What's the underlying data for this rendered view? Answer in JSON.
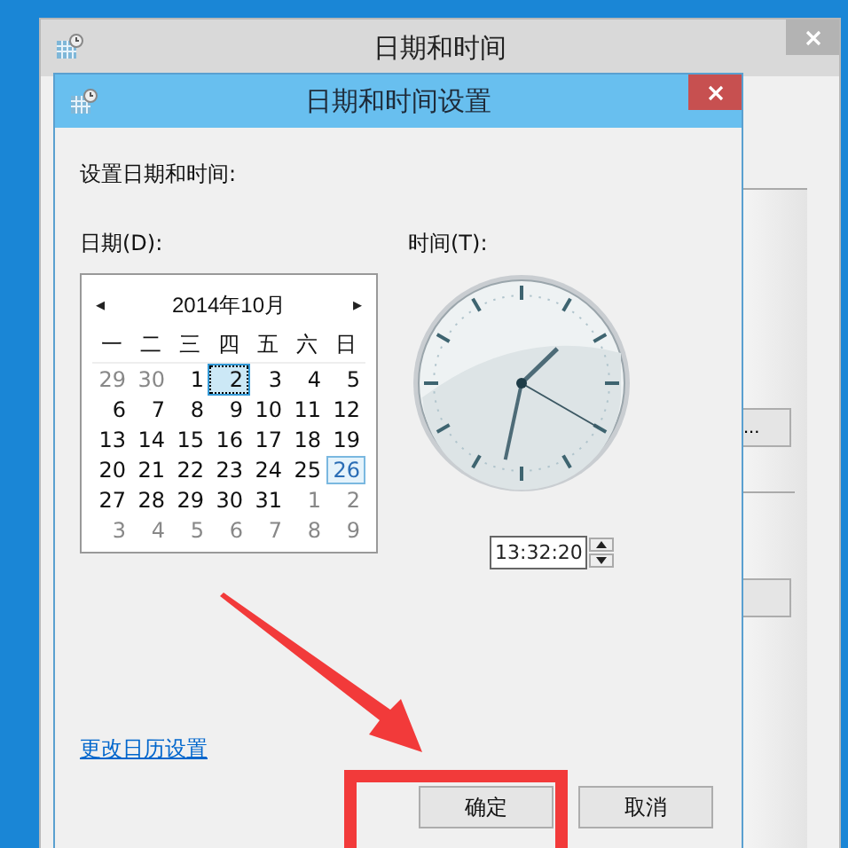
{
  "outer_window": {
    "title": "日期和时间",
    "side_buttons": [
      "..."
    ]
  },
  "dialog": {
    "title": "日期和时间设置",
    "heading": "设置日期和时间:",
    "date_label": "日期(D):",
    "time_label": "时间(T):",
    "calendar": {
      "prev": "◂",
      "next": "▸",
      "month": "2014年10月",
      "weekdays": [
        "一",
        "二",
        "三",
        "四",
        "五",
        "六",
        "日"
      ],
      "weeks": [
        [
          {
            "d": "29",
            "kind": "other",
            "selected": false,
            "today": false
          },
          {
            "d": "30",
            "kind": "other",
            "selected": false,
            "today": false
          },
          {
            "d": "1",
            "kind": "month",
            "selected": false,
            "today": false
          },
          {
            "d": "2",
            "kind": "month",
            "selected": true,
            "today": false
          },
          {
            "d": "3",
            "kind": "month",
            "selected": false,
            "today": false
          },
          {
            "d": "4",
            "kind": "month",
            "selected": false,
            "today": false
          },
          {
            "d": "5",
            "kind": "month",
            "selected": false,
            "today": false
          }
        ],
        [
          {
            "d": "6",
            "kind": "month",
            "selected": false,
            "today": false
          },
          {
            "d": "7",
            "kind": "month",
            "selected": false,
            "today": false
          },
          {
            "d": "8",
            "kind": "month",
            "selected": false,
            "today": false
          },
          {
            "d": "9",
            "kind": "month",
            "selected": false,
            "today": false
          },
          {
            "d": "10",
            "kind": "month",
            "selected": false,
            "today": false
          },
          {
            "d": "11",
            "kind": "month",
            "selected": false,
            "today": false
          },
          {
            "d": "12",
            "kind": "month",
            "selected": false,
            "today": false
          }
        ],
        [
          {
            "d": "13",
            "kind": "month",
            "selected": false,
            "today": false
          },
          {
            "d": "14",
            "kind": "month",
            "selected": false,
            "today": false
          },
          {
            "d": "15",
            "kind": "month",
            "selected": false,
            "today": false
          },
          {
            "d": "16",
            "kind": "month",
            "selected": false,
            "today": false
          },
          {
            "d": "17",
            "kind": "month",
            "selected": false,
            "today": false
          },
          {
            "d": "18",
            "kind": "month",
            "selected": false,
            "today": false
          },
          {
            "d": "19",
            "kind": "month",
            "selected": false,
            "today": false
          }
        ],
        [
          {
            "d": "20",
            "kind": "month",
            "selected": false,
            "today": false
          },
          {
            "d": "21",
            "kind": "month",
            "selected": false,
            "today": false
          },
          {
            "d": "22",
            "kind": "month",
            "selected": false,
            "today": false
          },
          {
            "d": "23",
            "kind": "month",
            "selected": false,
            "today": false
          },
          {
            "d": "24",
            "kind": "month",
            "selected": false,
            "today": false
          },
          {
            "d": "25",
            "kind": "month",
            "selected": false,
            "today": false
          },
          {
            "d": "26",
            "kind": "month",
            "selected": false,
            "today": true
          }
        ],
        [
          {
            "d": "27",
            "kind": "month",
            "selected": false,
            "today": false
          },
          {
            "d": "28",
            "kind": "month",
            "selected": false,
            "today": false
          },
          {
            "d": "29",
            "kind": "month",
            "selected": false,
            "today": false
          },
          {
            "d": "30",
            "kind": "month",
            "selected": false,
            "today": false
          },
          {
            "d": "31",
            "kind": "month",
            "selected": false,
            "today": false
          },
          {
            "d": "1",
            "kind": "other",
            "selected": false,
            "today": false
          },
          {
            "d": "2",
            "kind": "other",
            "selected": false,
            "today": false
          }
        ],
        [
          {
            "d": "3",
            "kind": "other",
            "selected": false,
            "today": false
          },
          {
            "d": "4",
            "kind": "other",
            "selected": false,
            "today": false
          },
          {
            "d": "5",
            "kind": "other",
            "selected": false,
            "today": false
          },
          {
            "d": "6",
            "kind": "other",
            "selected": false,
            "today": false
          },
          {
            "d": "7",
            "kind": "other",
            "selected": false,
            "today": false
          },
          {
            "d": "8",
            "kind": "other",
            "selected": false,
            "today": false
          },
          {
            "d": "9",
            "kind": "other",
            "selected": false,
            "today": false
          }
        ]
      ]
    },
    "time": "13:32:20",
    "link": "更改日历设置",
    "buttons": [
      "确定",
      "取消"
    ]
  }
}
